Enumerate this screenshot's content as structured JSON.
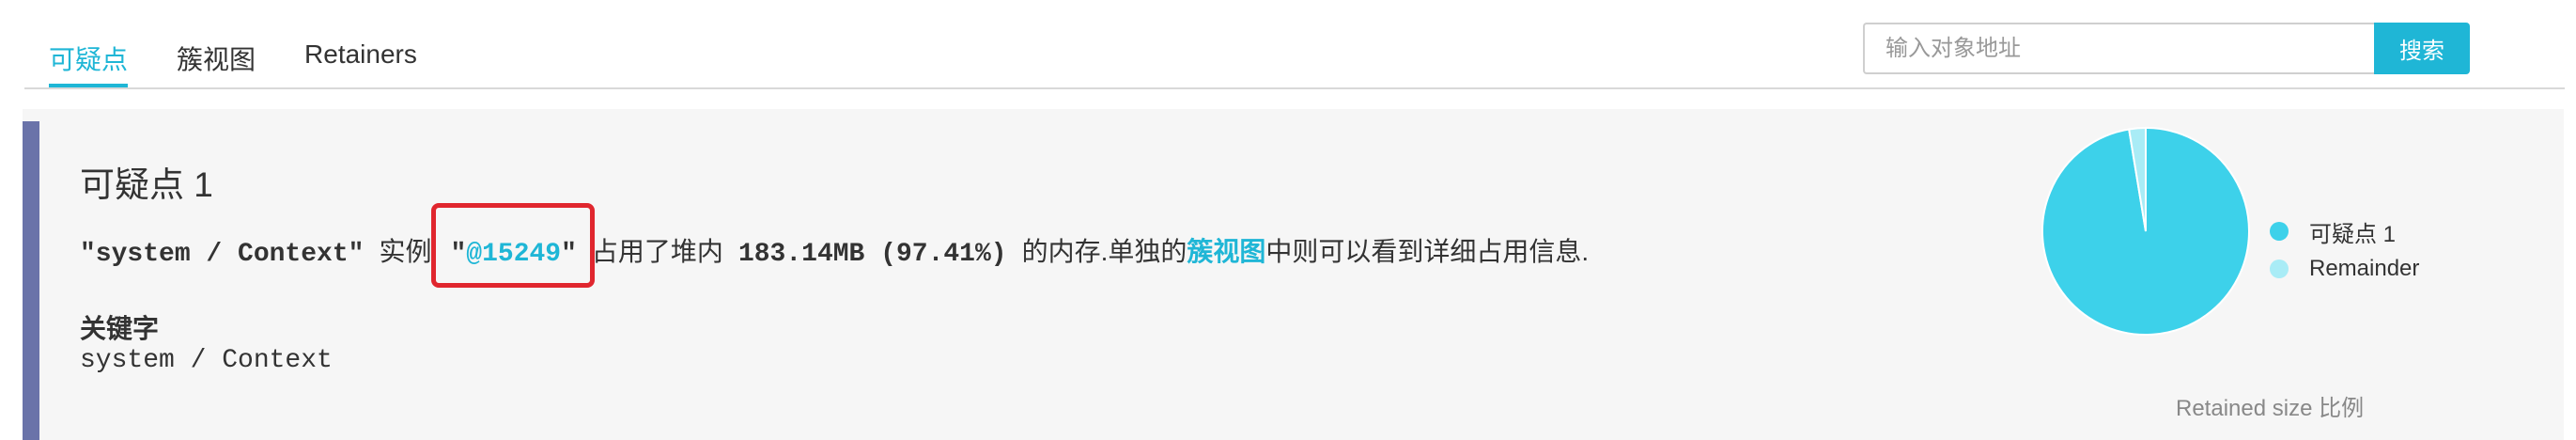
{
  "tabs": [
    {
      "label": "可疑点",
      "active": true
    },
    {
      "label": "簇视图",
      "active": false
    },
    {
      "label": "Retainers",
      "active": false
    }
  ],
  "search": {
    "placeholder": "输入对象地址",
    "button_label": "搜索"
  },
  "suspect": {
    "title": "可疑点 1",
    "object_name": "\"system / Context\"",
    "text_instance": "实例",
    "quote_open": "\"",
    "address": "@15249",
    "quote_close": "\"",
    "text_occupies": "占用了堆内",
    "size": "183.14MB (97.41%)",
    "text_memory": "的内存.单独的",
    "cluster_link": "簇视图",
    "text_detail": "中则可以看到详细占用信息.",
    "keywords_label": "关键字",
    "keywords_value": "system / Context"
  },
  "chart_data": {
    "type": "pie",
    "slices": [
      {
        "label": "可疑点 1",
        "value": 97.41,
        "color": "#3dd1ea"
      },
      {
        "label": "Remainder",
        "value": 2.59,
        "color": "#a9ecf6"
      }
    ],
    "legend_position": "right",
    "caption": "Retained size 比例"
  },
  "colors": {
    "accent": "#1fb6d6",
    "panel_bar": "#6a73a9",
    "highlight": "#e0262e"
  }
}
